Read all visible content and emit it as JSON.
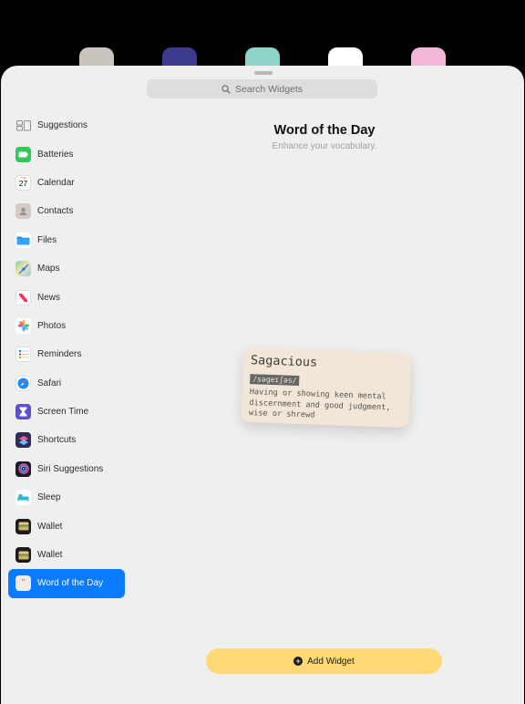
{
  "search": {
    "placeholder": "Search Widgets"
  },
  "sidebar": {
    "items": [
      {
        "label": "Suggestions",
        "icon": "suggestions-icon"
      },
      {
        "label": "Batteries",
        "icon": "batteries-icon"
      },
      {
        "label": "Calendar",
        "icon": "calendar-icon",
        "icon_text": "27",
        "icon_subtext": "TUE"
      },
      {
        "label": "Contacts",
        "icon": "contacts-icon"
      },
      {
        "label": "Files",
        "icon": "files-icon"
      },
      {
        "label": "Maps",
        "icon": "maps-icon"
      },
      {
        "label": "News",
        "icon": "news-icon"
      },
      {
        "label": "Photos",
        "icon": "photos-icon"
      },
      {
        "label": "Reminders",
        "icon": "reminders-icon"
      },
      {
        "label": "Safari",
        "icon": "safari-icon"
      },
      {
        "label": "Screen Time",
        "icon": "screen-time-icon"
      },
      {
        "label": "Shortcuts",
        "icon": "shortcuts-icon"
      },
      {
        "label": "Siri Suggestions",
        "icon": "siri-icon"
      },
      {
        "label": "Sleep",
        "icon": "sleep-icon"
      },
      {
        "label": "Wallet",
        "icon": "wallet-icon"
      },
      {
        "label": "Wallet",
        "icon": "wallet-icon"
      },
      {
        "label": "Word of the Day",
        "icon": "quote-icon",
        "selected": true
      }
    ]
  },
  "detail": {
    "title": "Word of the Day",
    "subtitle": "Enhance your vocabulary."
  },
  "widget": {
    "word": "Sagacious",
    "phonetic": "/səɡeɪʃəs/",
    "definition": "Having or showing keen mental discernment and good judgment, wise or shrewd"
  },
  "footer": {
    "add_label": "Add Widget"
  },
  "colors": {
    "accent": "#0a7aff",
    "add_button": "#fdda75",
    "widget_bg": "#f1e6d7"
  }
}
